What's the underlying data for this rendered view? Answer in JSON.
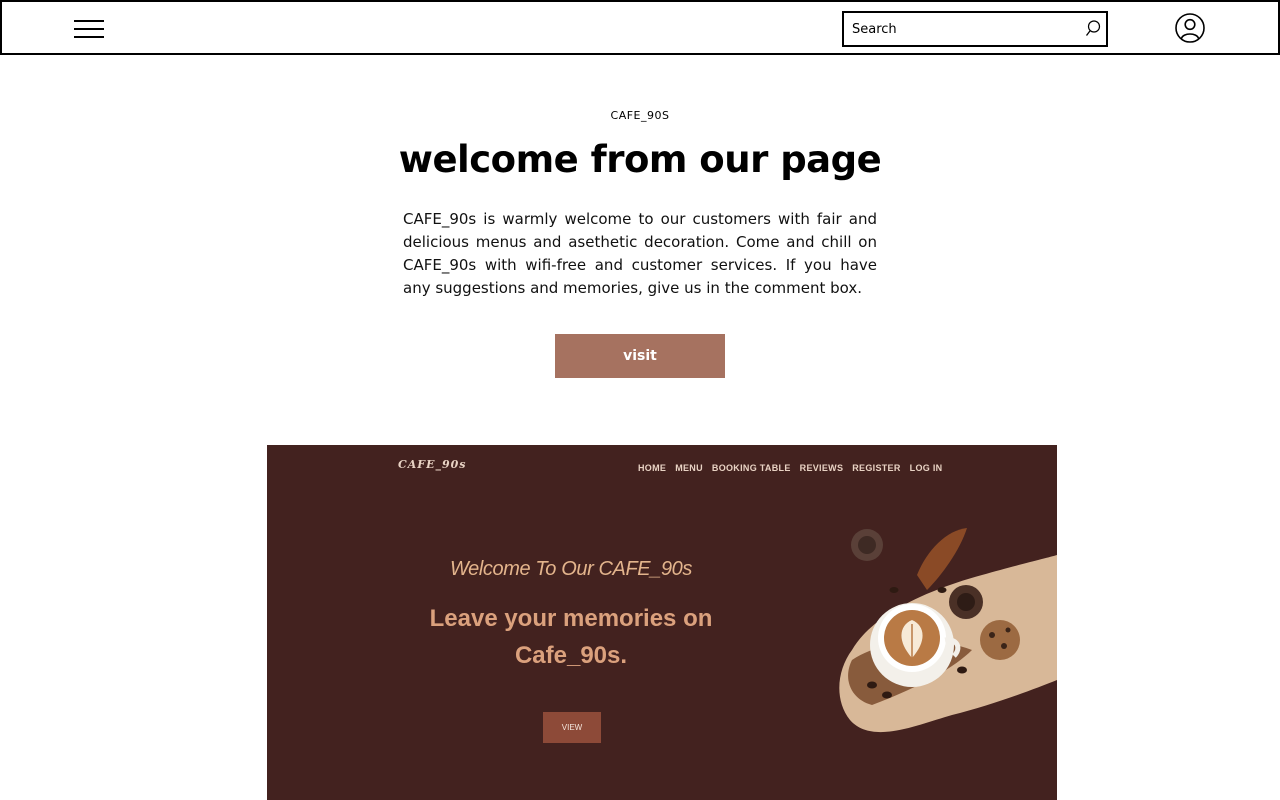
{
  "header": {
    "search_placeholder": "Search"
  },
  "hero": {
    "eyebrow": "CAFE_90S",
    "title": "welcome from our page",
    "description": "CAFE_90s is warmly welcome to our customers with fair and delicious menus and asethetic decoration. Come and chill on CAFE_90s with wifi-free and customer services. If you have any suggestions and memories, give us in the comment box.",
    "visit_label": "visit",
    "accent_color": "#a67260"
  },
  "preview": {
    "logo": "CAFE_90s",
    "nav": [
      "HOME",
      "MENU",
      "BOOKING TABLE",
      "REVIEWS",
      "REGISTER",
      "LOG IN"
    ],
    "welcome": "Welcome To Our CAFE_90s",
    "tagline_line1": "Leave your memories on",
    "tagline_line2": "Cafe_90s.",
    "view_label": "VIEW",
    "background_color": "#43221f"
  },
  "icons": [
    "hamburger-menu-icon",
    "search-icon",
    "user-account-icon",
    "coffee-illustration"
  ]
}
